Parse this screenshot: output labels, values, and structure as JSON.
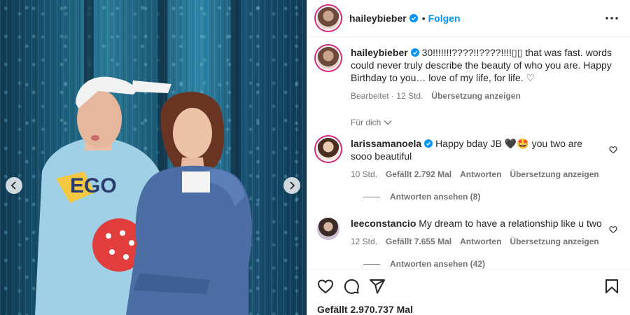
{
  "post": {
    "username": "haileybieber",
    "separator": "•",
    "follow_label": "Folgen"
  },
  "caption": {
    "username": "haileybieber",
    "text": "30!!!!!!!????!!????!!!!▯▯ that was fast. words could never truly describe the beauty of who you are. Happy Birthday to you… love of my life, for life. ♡",
    "edited_label": "Bearbeitet",
    "meta_sep": "·",
    "time": "12 Std.",
    "translate_label": "Übersetzung anzeigen"
  },
  "for_you_label": "Für dich",
  "comments": [
    {
      "username": "larissamanoela",
      "verified": true,
      "text": "Happy bday JB 🖤🤩 you two are sooo beautiful",
      "time": "10 Std.",
      "likes": "Gefällt 2.792 Mal",
      "reply_label": "Antworten",
      "translate_label": "Übersetzung anzeigen",
      "view_replies": "Antworten ansehen (8)"
    },
    {
      "username": "leeconstancio",
      "verified": false,
      "text": "My dream to have a relationship like u two",
      "time": "12 Std.",
      "likes": "Gefällt 7.655 Mal",
      "reply_label": "Antworten",
      "translate_label": "Übersetzung anzeigen",
      "view_replies": "Antworten ansehen (42)"
    }
  ],
  "likes_total": "Gefällt 2.970.737 Mal",
  "colors": {
    "accent": "#0095f6",
    "verified": "#0095f6",
    "muted": "#737373",
    "text": "#262626"
  },
  "icons": [
    "heart-icon",
    "comment-icon",
    "share-icon",
    "bookmark-icon",
    "more-icon",
    "chevron-left-icon",
    "chevron-right-icon",
    "verified-icon",
    "chevron-down-icon"
  ]
}
